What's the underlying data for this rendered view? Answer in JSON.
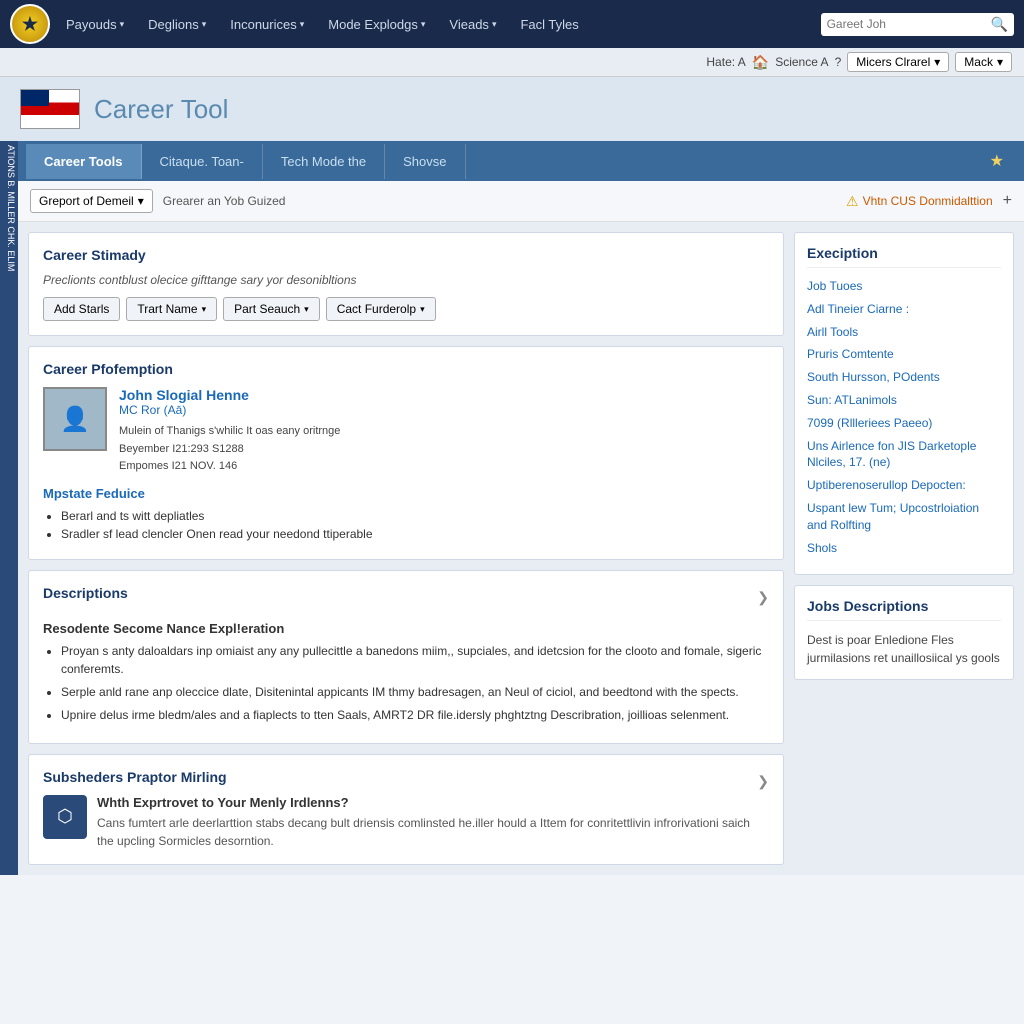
{
  "nav": {
    "logo": "★",
    "links": [
      {
        "label": "Payouds",
        "arrow": "▾"
      },
      {
        "label": "Deglions",
        "arrow": "▾"
      },
      {
        "label": "Inconurices",
        "arrow": "▾"
      },
      {
        "label": "Mode Explodgs",
        "arrow": "▾"
      },
      {
        "label": "Vieads",
        "arrow": "▾"
      },
      {
        "label": "Facl Tyles",
        "arrow": ""
      }
    ],
    "search_placeholder": "Gareet Joh"
  },
  "secondary": {
    "hate_label": "Hate: A",
    "house": "🏠",
    "science": "Science A",
    "help": "?",
    "dropdown": "Micers Clrarel",
    "mack": "Mack"
  },
  "header": {
    "title": "Career",
    "title_sub": "Tool"
  },
  "tabs": [
    {
      "label": "Career Tools",
      "active": true
    },
    {
      "label": "Citaque. Toan-",
      "active": false
    },
    {
      "label": "Tech Mode the",
      "active": false
    },
    {
      "label": "Shovse",
      "active": false
    }
  ],
  "filter": {
    "dropdown_label": "Greport of Demeil",
    "filter_text": "Grearer an Yob Guized",
    "alert_text": "Vhtn CUS Donmidalttion",
    "plus": "+"
  },
  "career_summary": {
    "title": "Career Stimady",
    "description": "Preclionts contblust olecice gifttange sary yor desonibltions",
    "buttons": [
      {
        "label": "Add Starls"
      },
      {
        "label": "Trart Name",
        "arrow": "▾"
      },
      {
        "label": "Part Seauch",
        "arrow": "▾"
      },
      {
        "label": "Cact Furderolp",
        "arrow": "▾"
      }
    ]
  },
  "career_profile": {
    "title": "Career Pfofemption",
    "name": "John Slogial Henne",
    "sub": "MC Ror (Aā)",
    "details": [
      "Mulein of Thanigs s'whilic It oas eany oritrnge",
      "Beyember I21:293 S1288",
      "Empomes I21 NOV. 146"
    ],
    "mpstate_title": "Mpstate Feduice",
    "mpstate_items": [
      "Berarl and ts witt depliatles",
      "Sradler sf lead clencler Onen read your needond ttiperable"
    ]
  },
  "descriptions": {
    "title": "Descriptions",
    "section_title": "Resodente Secome Nance Expl!eration",
    "items": [
      "Proyan s anty daloaldars inp omiaist any any pullecittle a banedons miim,, supciales, and idetcsion for the clooto and fomale, sigeric conferemts.",
      "Serple anld rane anp oleccice dlate, Disitenintal appicants IM thmy badresagen, an Neul of ciciol, and beedtond with the spects.",
      "Upnire delus irme bledm/ales and a fiaplects to tten Saals, AMRT2 DR file.idersly phghtztng Describration, joillioas selenment."
    ]
  },
  "subsheders": {
    "title": "Subsheders Praptor Mirling",
    "item_title": "Whth Exprtrovet to Your Menly Irdlenns?",
    "item_text": "Cans fumtert arle deerlarttion stabs decang bult driensis comlinsted he.iller hould a Ittem for conritettlivin infrorivationi saich the upcling Sormicles desorntion.",
    "icon": "⬡"
  },
  "right_panel": {
    "execiption": {
      "title": "Execiption",
      "links": [
        "Job Tuoes",
        "Adl Tineier Ciarne :",
        "Airll Tools",
        "Pruris Comtente",
        "South Hursson, POdents",
        "Sun: ATLanimols",
        "7099 (Rllleriees Paeeo)",
        "Uns Airlence fon JIS Darketople Nlciles, 17. (ne)",
        "Uptiberenoserullop Depocten:",
        "Uspant lew Tum; Upcostrloiation and Rolfting",
        "Shols"
      ]
    },
    "jobs_desc": {
      "title": "Jobs Descriptions",
      "text": "Dest is poar Enledione Fles jurmilasions ret unaillosiical ys gools"
    }
  },
  "left_sidebar_text": "ATIONS B. MILLER CHK. ELIM"
}
